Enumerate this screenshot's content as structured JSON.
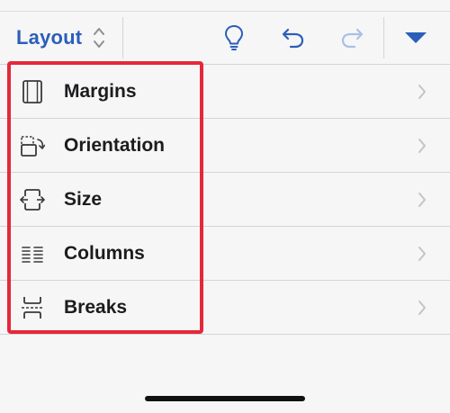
{
  "toolbar": {
    "tab_label": "Layout",
    "icons": [
      "chevron-up-down-icon",
      "lightbulb-icon",
      "undo-icon",
      "redo-icon",
      "triangle-down-icon"
    ],
    "accent_color": "#2b5fb8",
    "redo_disabled_color": "#a9c0e6"
  },
  "menu": {
    "items": [
      {
        "label": "Margins",
        "icon": "margins-icon"
      },
      {
        "label": "Orientation",
        "icon": "orientation-icon"
      },
      {
        "label": "Size",
        "icon": "size-icon"
      },
      {
        "label": "Columns",
        "icon": "columns-icon"
      },
      {
        "label": "Breaks",
        "icon": "breaks-icon"
      }
    ]
  },
  "highlight_color": "#e5283a"
}
